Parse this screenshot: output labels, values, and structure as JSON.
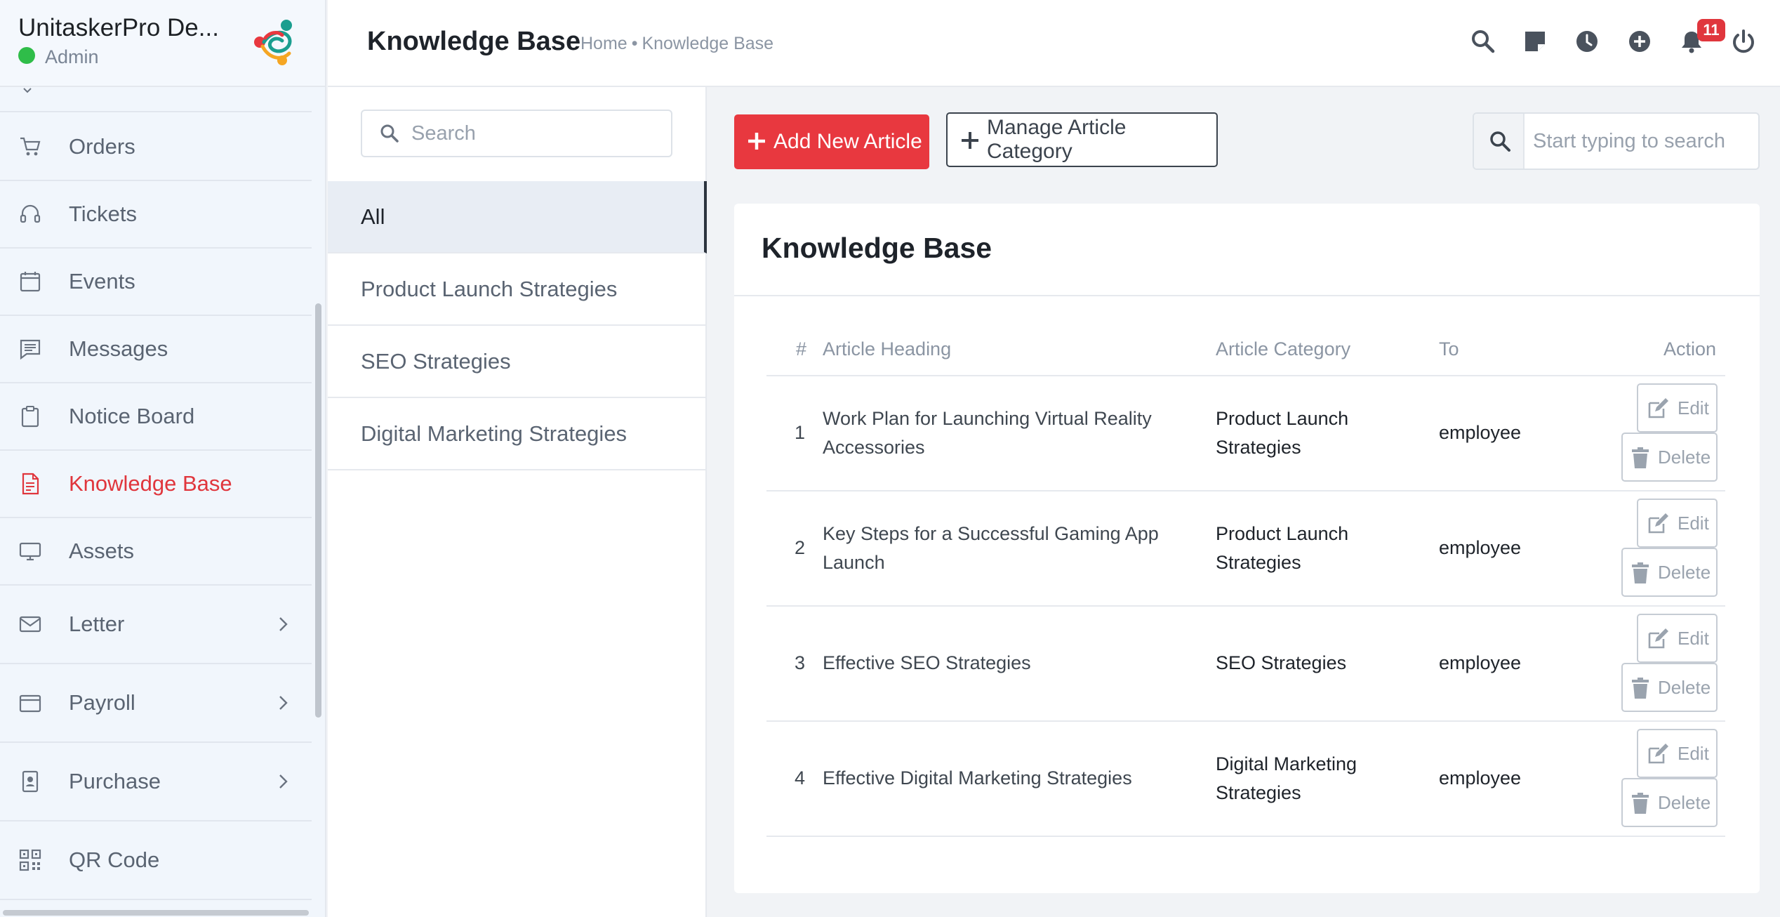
{
  "sidebar": {
    "company_name": "UnitaskerPro De...",
    "user_role": "Admin",
    "items": [
      {
        "label": "Orders",
        "icon": "cart-icon"
      },
      {
        "label": "Tickets",
        "icon": "headset-icon"
      },
      {
        "label": "Events",
        "icon": "calendar-icon"
      },
      {
        "label": "Messages",
        "icon": "message-icon"
      },
      {
        "label": "Notice Board",
        "icon": "clipboard-icon"
      },
      {
        "label": "Knowledge Base",
        "icon": "document-icon",
        "active": true
      },
      {
        "label": "Assets",
        "icon": "monitor-icon"
      },
      {
        "label": "Letter",
        "icon": "envelope-icon",
        "has_submenu": true
      },
      {
        "label": "Payroll",
        "icon": "wallet-icon",
        "has_submenu": true
      },
      {
        "label": "Purchase",
        "icon": "badge-icon",
        "has_submenu": true
      },
      {
        "label": "QR Code",
        "icon": "qr-code-icon"
      }
    ]
  },
  "header": {
    "title": "Knowledge Base",
    "breadcrumb": [
      "Home",
      "Knowledge Base"
    ],
    "breadcrumb_separator": "•",
    "notification_count": "11",
    "icons": [
      "search-icon",
      "sticky-note-icon",
      "clock-icon",
      "add-circle-icon",
      "bell-icon",
      "power-icon"
    ]
  },
  "categories": {
    "search_placeholder": "Search",
    "items": [
      "All",
      "Product Launch Strategies",
      "SEO Strategies",
      "Digital Marketing Strategies"
    ],
    "active": "All"
  },
  "toolbar": {
    "add_label": "Add New Article",
    "manage_label": "Manage Article Category",
    "search_placeholder": "Start typing to search"
  },
  "kb": {
    "card_title": "Knowledge Base",
    "columns": [
      "#",
      "Article Heading",
      "Article Category",
      "To",
      "Action"
    ],
    "rows": [
      {
        "num": "1",
        "heading": "Work Plan for Launching Virtual Reality Accessories",
        "category": "Product Launch Strategies",
        "to": "employee"
      },
      {
        "num": "2",
        "heading": "Key Steps for a Successful Gaming App Launch",
        "category": "Product Launch Strategies",
        "to": "employee"
      },
      {
        "num": "3",
        "heading": "Effective SEO Strategies",
        "category": "SEO Strategies",
        "to": "employee"
      },
      {
        "num": "4",
        "heading": "Effective Digital Marketing Strategies",
        "category": "Digital Marketing Strategies",
        "to": "employee"
      }
    ],
    "edit_label": "Edit",
    "delete_label": "Delete"
  },
  "colors": {
    "accent": "#e8383f",
    "status_online": "#2fbd49",
    "sidebar_bg": "#f1f6fc"
  }
}
